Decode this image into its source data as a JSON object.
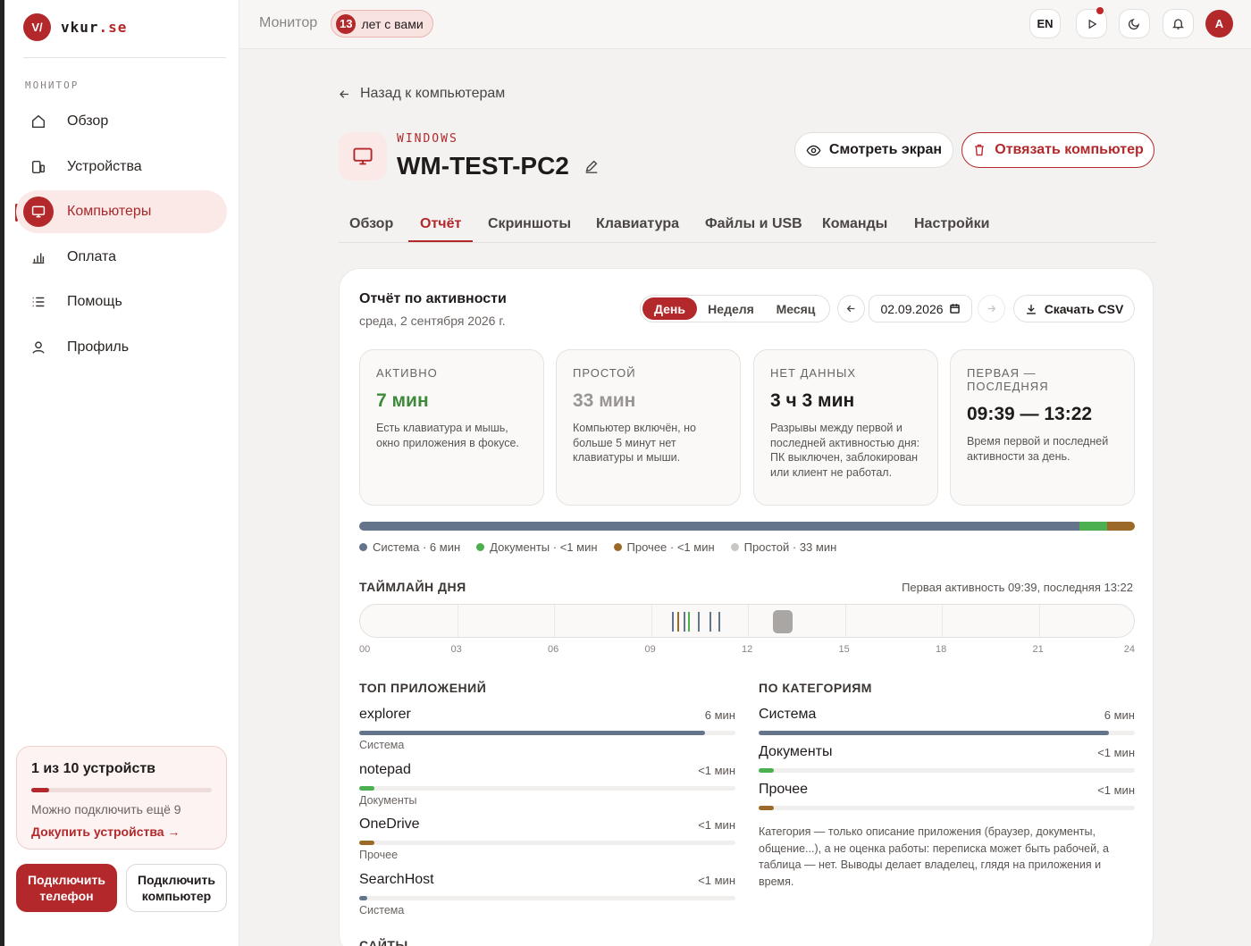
{
  "app": {
    "logo_mark": "V/",
    "logo_name": "vkur",
    "logo_domain": ".se"
  },
  "sidebar": {
    "section_label": "МОНИТОР",
    "items": [
      {
        "label": "Обзор",
        "icon": "home-icon"
      },
      {
        "label": "Устройства",
        "icon": "devices-icon"
      },
      {
        "label": "Компьютеры",
        "icon": "monitor-icon",
        "active": true
      },
      {
        "label": "Оплата",
        "icon": "chart-icon"
      },
      {
        "label": "Помощь",
        "icon": "list-icon"
      },
      {
        "label": "Профиль",
        "icon": "user-icon"
      }
    ],
    "devices_box": {
      "title": "1 из 10 устройств",
      "progress": 0.1,
      "subtitle": "Можно подключить ещё 9",
      "link": "Докупить устройства →"
    },
    "btn_phone": "Подключить телефон",
    "btn_pc": "Подключить компьютер"
  },
  "topbar": {
    "crumb": "Монитор",
    "years_num": "13",
    "years_text": "лет с вами",
    "lang": "EN",
    "avatar": "A"
  },
  "header": {
    "back": "Назад к компьютерам",
    "os": "WINDOWS",
    "name": "WM-TEST-PC2",
    "btn_watch": "Смотреть экран",
    "btn_unbind": "Отвязать компьютер"
  },
  "tabs": [
    "Обзор",
    "Отчёт",
    "Скриншоты",
    "Клавиатура",
    "Файлы и USB",
    "Команды",
    "Настройки"
  ],
  "active_tab": "Отчёт",
  "report": {
    "title": "Отчёт по активности",
    "date_long": "среда, 2 сентября 2026 г.",
    "periods": [
      "День",
      "Неделя",
      "Месяц"
    ],
    "active_period": "День",
    "date": "02.09.2026",
    "csv": "Скачать CSV",
    "stats": [
      {
        "key": "АКТИВНО",
        "value": "7 мин",
        "desc": "Есть клавиатура и мышь, окно приложения в фокусе.",
        "color": "#3f8a3a"
      },
      {
        "key": "ПРОСТОЙ",
        "value": "33 мин",
        "desc": "Компьютер включён, но больше 5 минут нет клавиатуры и мыши.",
        "color": "#9a9593"
      },
      {
        "key": "НЕТ ДАННЫХ",
        "value": "3 ч 3 мин",
        "desc": "Разрывы между первой и последней активностью дня: ПК выключен, заблокирован или клиент не работал.",
        "color": "#1f1b1a"
      },
      {
        "key": "ПЕРВАЯ — ПОСЛЕДНЯЯ",
        "value": "09:39 — 13:22",
        "desc": "Время первой и последней активности за день.",
        "color": "#1f1b1a"
      }
    ],
    "breakdown": [
      {
        "label": "Система · 6 мин",
        "color": "#64748b",
        "share": 0.928
      },
      {
        "label": "Документы · <1 мин",
        "color": "#4caf50",
        "share": 0.036
      },
      {
        "label": "Прочее · <1 мин",
        "color": "#9c6a28",
        "share": 0.036
      },
      {
        "label": "Простой · 33 мин",
        "color": "#c9c6c4",
        "share": 0
      }
    ],
    "timeline": {
      "title": "ТАЙМЛАЙН ДНЯ",
      "note": "Первая активность 09:39, последняя 13:22",
      "ticks": [
        "00",
        "03",
        "06",
        "09",
        "12",
        "15",
        "18",
        "21",
        "24"
      ],
      "marks": [
        {
          "hour": 9.65,
          "color": "#64748b"
        },
        {
          "hour": 9.82,
          "color": "#9c6a28"
        },
        {
          "hour": 10.0,
          "color": "#64748b"
        },
        {
          "hour": 10.15,
          "color": "#4caf50"
        },
        {
          "hour": 10.45,
          "color": "#64748b"
        },
        {
          "hour": 10.8,
          "color": "#64748b"
        },
        {
          "hour": 11.1,
          "color": "#64748b"
        }
      ],
      "idle_block": {
        "start_hour": 12.78,
        "end_hour": 13.37
      }
    },
    "top_apps": {
      "title": "ТОП ПРИЛОЖЕНИЙ",
      "items": [
        {
          "name": "explorer",
          "time": "6 мин",
          "category": "Система",
          "share": 0.92,
          "color": "#64748b"
        },
        {
          "name": "notepad",
          "time": "<1 мин",
          "category": "Документы",
          "share": 0.04,
          "color": "#4caf50"
        },
        {
          "name": "OneDrive",
          "time": "<1 мин",
          "category": "Прочее",
          "share": 0.04,
          "color": "#9c6a28"
        },
        {
          "name": "SearchHost",
          "time": "<1 мин",
          "category": "Система",
          "share": 0.02,
          "color": "#64748b"
        }
      ]
    },
    "categories": {
      "title": "ПО КАТЕГОРИЯМ",
      "items": [
        {
          "name": "Система",
          "time": "6 мин",
          "share": 0.93,
          "color": "#64748b"
        },
        {
          "name": "Документы",
          "time": "<1 мин",
          "share": 0.04,
          "color": "#4caf50"
        },
        {
          "name": "Прочее",
          "time": "<1 мин",
          "share": 0.04,
          "color": "#9c6a28"
        }
      ],
      "note": "Категория — только описание приложения (браузер, документы, общение...), а не оценка работы: переписка может быть рабочей, а таблица — нет. Выводы делает владелец, глядя на приложения и время."
    },
    "sites_title": "САЙТЫ"
  }
}
